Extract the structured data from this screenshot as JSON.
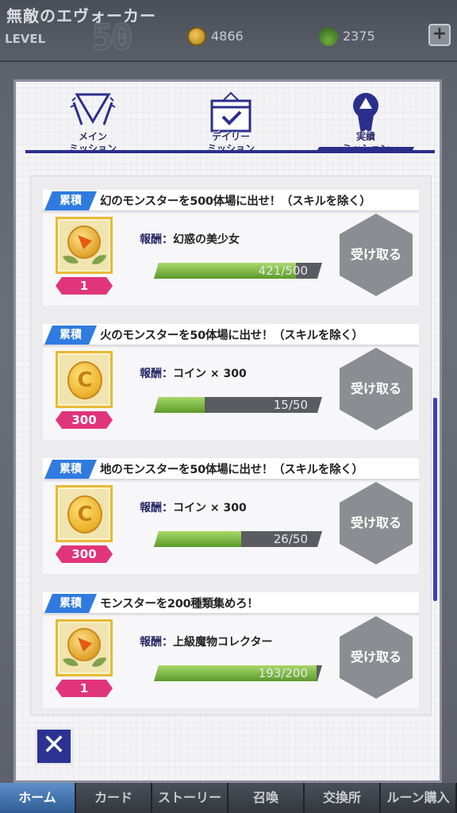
{
  "background": {
    "player_name": "無敵のエヴォーカー",
    "level_label": "LEVEL",
    "level_value": "50",
    "coins": "4866",
    "gems": "2375",
    "plus_label": "+",
    "nav_tabs": [
      "ホーム",
      "カード",
      "ストーリー",
      "召喚",
      "交換所",
      "ルーン購入"
    ]
  },
  "tabs": {
    "main": "メイン\nミッション",
    "daily": "デイリー\nミッション",
    "achievement": "実績\nミッション"
  },
  "reward_prefix": "報酬：",
  "receive_label": "受け取る",
  "missions": [
    {
      "tag": "累積",
      "title": "幻のモンスターを500体場に出せ！（スキルを除く）",
      "reward": "幻惑の美少女",
      "reward_icon": "medal-icon",
      "qty": "1",
      "progress_text": "421/500",
      "progress_fraction": 0.842
    },
    {
      "tag": "累積",
      "title": "火のモンスターを50体場に出せ！（スキルを除く）",
      "reward": "コイン × 300",
      "reward_icon": "coin-icon",
      "coin_letter": "C",
      "qty": "300",
      "progress_text": "15/50",
      "progress_fraction": 0.3
    },
    {
      "tag": "累積",
      "title": "地のモンスターを50体場に出せ！（スキルを除く）",
      "reward": "コイン × 300",
      "reward_icon": "coin-icon",
      "coin_letter": "C",
      "qty": "300",
      "progress_text": "26/50",
      "progress_fraction": 0.52
    },
    {
      "tag": "累積",
      "title": "モンスターを200種類集めろ！",
      "reward": "上級魔物コレクター",
      "reward_icon": "medal-icon",
      "qty": "1",
      "progress_text": "193/200",
      "progress_fraction": 0.965
    }
  ],
  "close_label": "✕"
}
